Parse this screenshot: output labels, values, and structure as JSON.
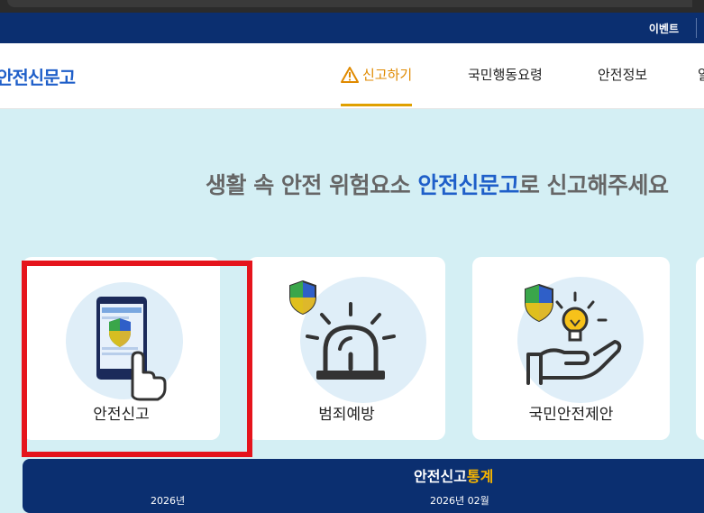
{
  "topbar": {
    "event_label": "이벤트"
  },
  "header": {
    "logo": "안전신문고",
    "nav": {
      "report": "신고하기",
      "action": "국민행동요령",
      "info": "안전정보",
      "partial": "알"
    }
  },
  "hero": {
    "headline_pre": "생활 속 안전 위험요소 ",
    "headline_brand": "안전신문고",
    "headline_post": "로 신고해주세요"
  },
  "cards": [
    {
      "label": "안전신고",
      "icon": "phone-touch-icon"
    },
    {
      "label": "범죄예방",
      "icon": "siren-icon"
    },
    {
      "label": "국민안전제안",
      "icon": "hand-lightbulb-icon"
    }
  ],
  "stats": {
    "title_pre": "안전신고",
    "title_accent": "통계",
    "date_year": "2026년",
    "date_month": "2026년 02월"
  },
  "colors": {
    "brand_blue": "#1f5fc9",
    "navy": "#0b2f70",
    "warning_orange": "#e08a00",
    "highlight_red": "#e5141c",
    "page_bg": "#d4eff4"
  }
}
